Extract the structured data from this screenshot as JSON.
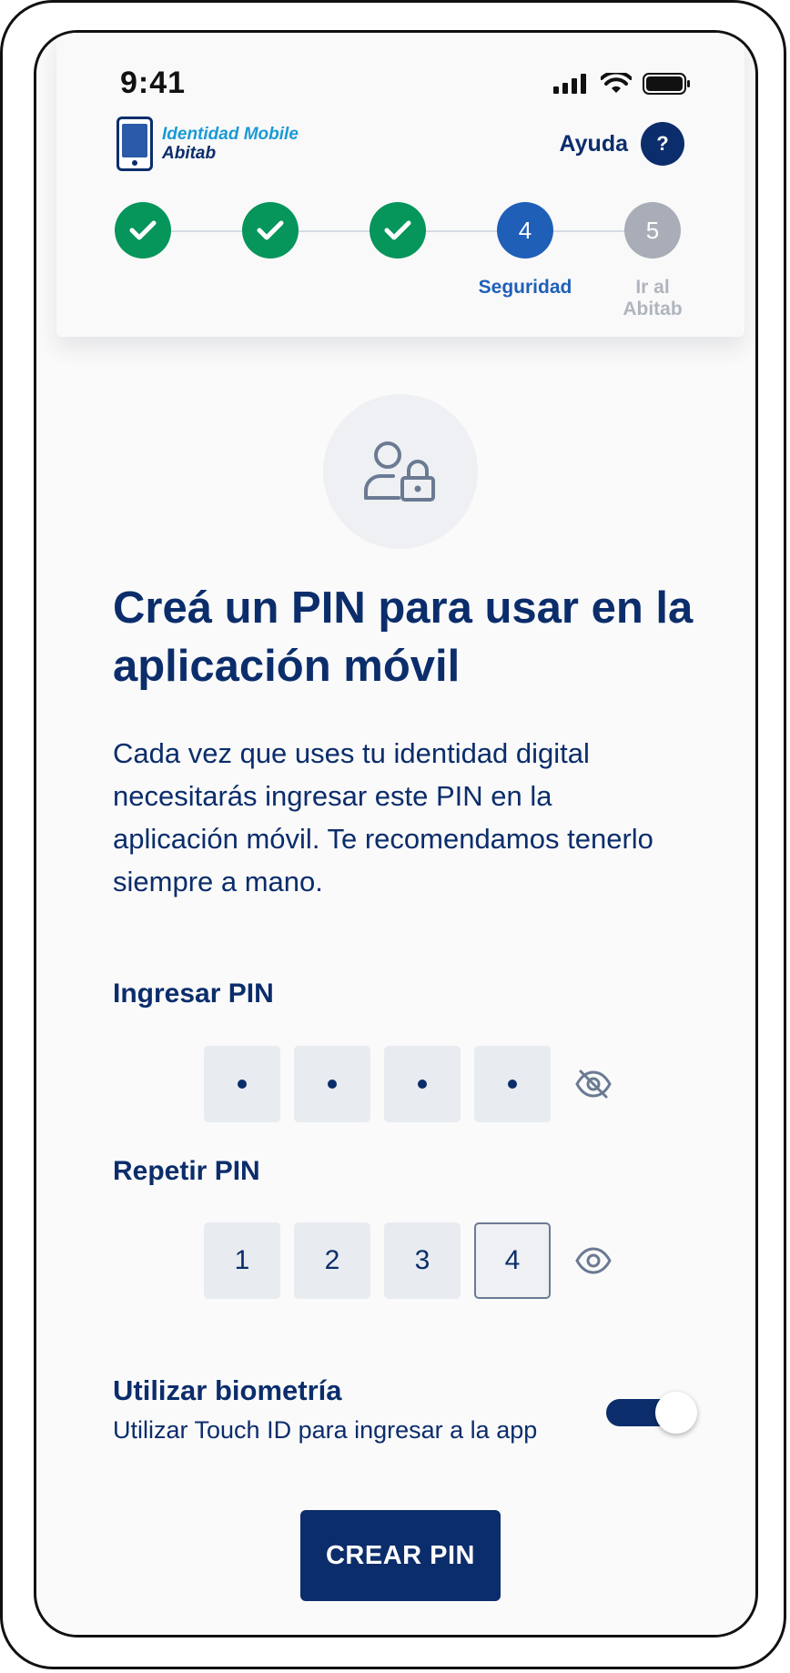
{
  "status_bar": {
    "time": "9:41",
    "icons": [
      "signal-icon",
      "wifi-icon",
      "battery-icon"
    ]
  },
  "header": {
    "logo_line1": "Identidad Mobile",
    "logo_line2": "Abitab",
    "help_label": "Ayuda",
    "help_icon_text": "?"
  },
  "stepper": {
    "steps": [
      {
        "number": "1",
        "state": "done",
        "label": ""
      },
      {
        "number": "2",
        "state": "done",
        "label": ""
      },
      {
        "number": "3",
        "state": "done",
        "label": ""
      },
      {
        "number": "4",
        "state": "active",
        "label": "Seguridad"
      },
      {
        "number": "5",
        "state": "todo",
        "label": "Ir al Abitab"
      }
    ]
  },
  "main": {
    "icon": "user-lock-icon",
    "title": "Creá un PIN para usar en la aplicación móvil",
    "description": "Cada vez que uses tu identidad digital necesitarás ingresar este PIN en la aplicación móvil. Te recomendamos tenerlo siempre a mano.",
    "pin_label": "Ingresar PIN",
    "pin_digits": [
      "•",
      "•",
      "•",
      "•"
    ],
    "repeat_label": "Repetir PIN",
    "repeat_digits": [
      "1",
      "2",
      "3",
      "4"
    ],
    "biometrics_title": "Utilizar biometría",
    "biometrics_subtitle": "Utilizar Touch ID para ingresar a la app",
    "biometrics_enabled": true,
    "cta_label": "CREAR PIN"
  },
  "colors": {
    "primary": "#0b2d6b",
    "active_step": "#1f5fb8",
    "done_step": "#06955b",
    "todo_step": "#a8adb7"
  }
}
